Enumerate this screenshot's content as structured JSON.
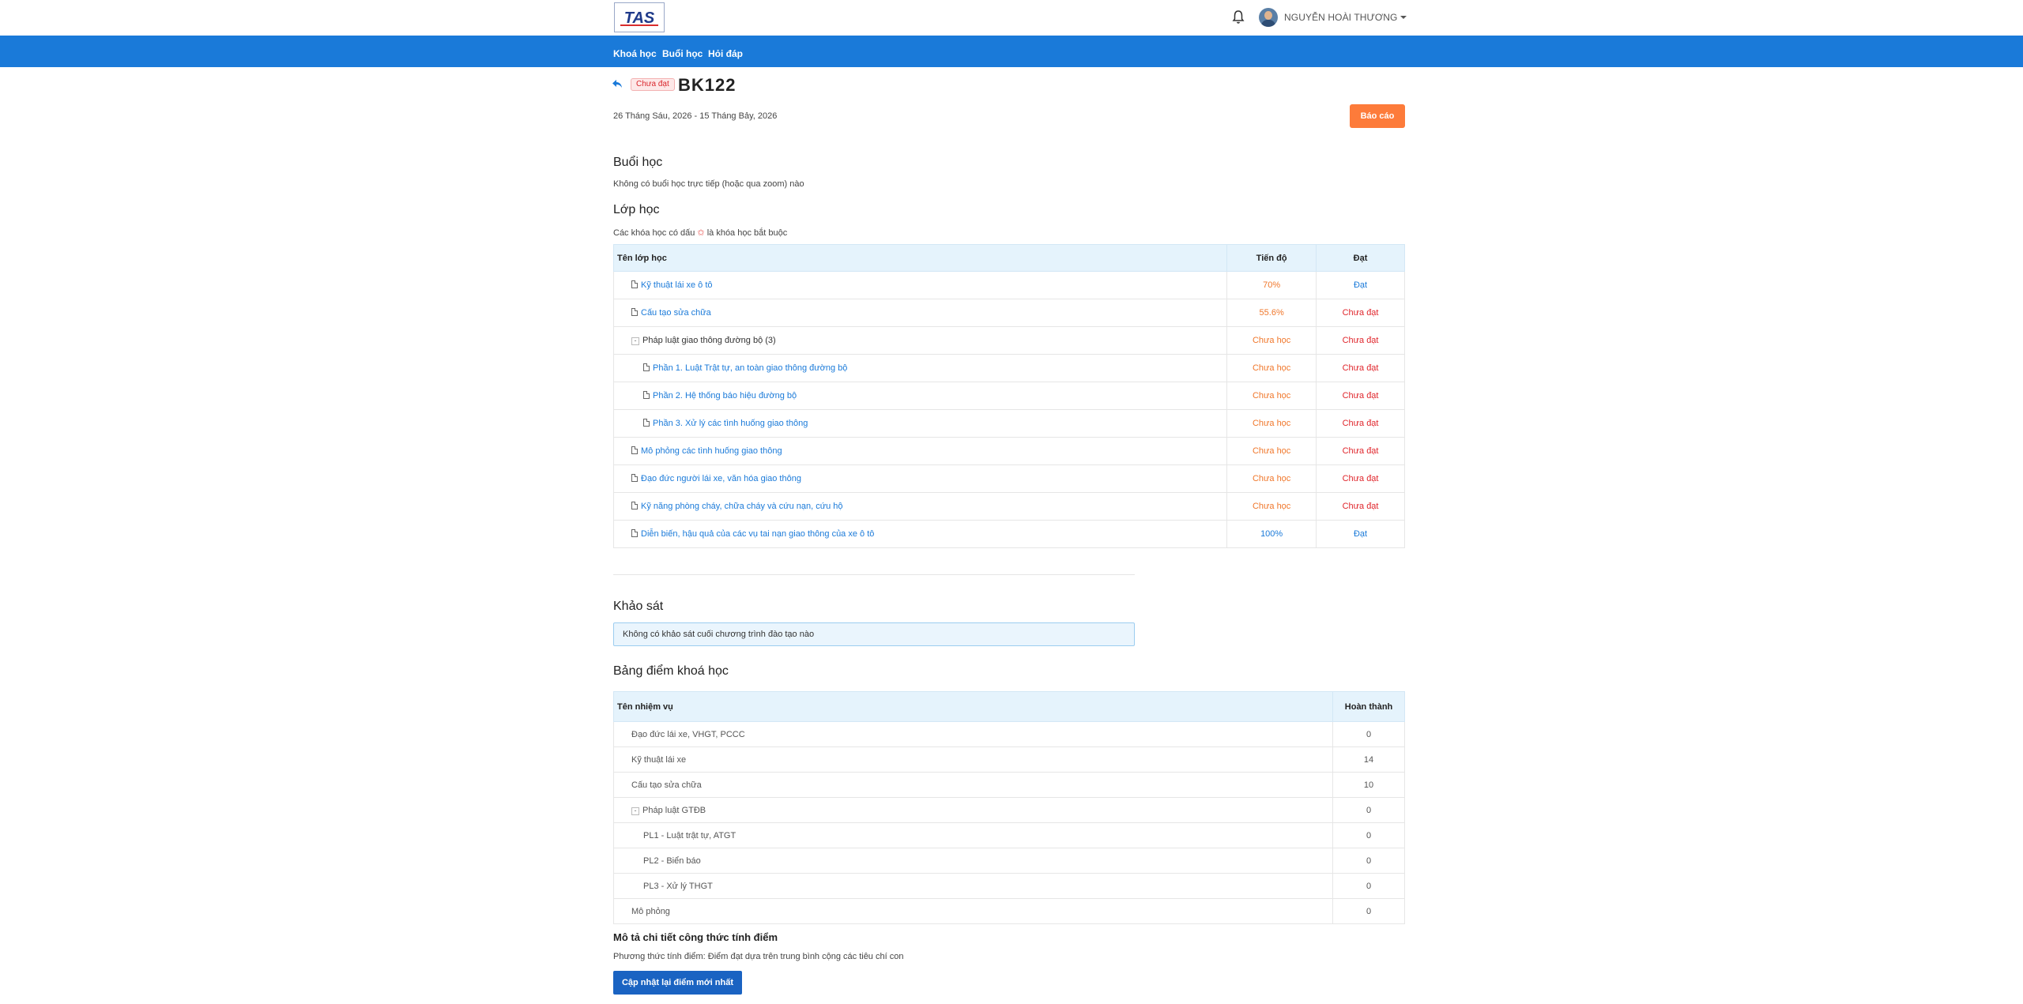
{
  "header": {
    "logo_text": "TAS",
    "user_name": "NGUYỄN HOÀI THƯƠNG"
  },
  "nav": {
    "items": [
      "Khoá học",
      "Buổi học",
      "Hỏi đáp"
    ]
  },
  "course": {
    "status_badge": "Chưa đạt",
    "code": "BK122",
    "date_range": "26 Tháng Sáu, 2026 - 15 Tháng Bảy, 2026",
    "report_button": "Báo cáo"
  },
  "sessions": {
    "title": "Buổi học",
    "empty_text": "Không có buổi học trực tiếp (hoặc qua zoom) nào"
  },
  "classes": {
    "title": "Lớp học",
    "note_before": "Các khóa học có dấu",
    "note_star": "✩",
    "note_after": "là khóa học bắt buộc",
    "headers": {
      "name": "Tên lớp học",
      "progress": "Tiến độ",
      "pass": "Đạt"
    },
    "rows": [
      {
        "name": "Kỹ thuật lái xe ô tô",
        "progress": "70%",
        "pass": "Đạt"
      },
      {
        "name": "Cấu tạo sửa chữa",
        "progress": "55.6%",
        "pass": "Chưa đạt"
      },
      {
        "name": "Pháp luật giao thông đường bộ",
        "count": "(3)",
        "progress": "Chưa học",
        "pass": "Chưa đạt"
      },
      {
        "name": "Phần 1. Luật Trật tự, an toàn giao thông đường bộ",
        "progress": "Chưa học",
        "pass": "Chưa đạt"
      },
      {
        "name": "Phần 2. Hệ thống báo hiệu đường bộ",
        "progress": "Chưa học",
        "pass": "Chưa đạt"
      },
      {
        "name": "Phần 3. Xử lý các tình huống giao thông",
        "progress": "Chưa học",
        "pass": "Chưa đạt"
      },
      {
        "name": "Mô phỏng các tình huống giao thông",
        "progress": "Chưa học",
        "pass": "Chưa đạt"
      },
      {
        "name": "Đạo đức người lái xe, văn hóa giao thông",
        "progress": "Chưa học",
        "pass": "Chưa đạt"
      },
      {
        "name": "Kỹ năng phòng cháy, chữa cháy và cứu nạn, cứu hộ",
        "progress": "Chưa học",
        "pass": "Chưa đạt"
      },
      {
        "name": "Diễn biến, hậu quả của các vụ tai nạn giao thông của xe ô tô",
        "progress": "100%",
        "pass": "Đạt"
      }
    ]
  },
  "survey": {
    "title": "Khảo sát",
    "empty_text": "Không có khảo sát cuối chương trình đào tạo nào"
  },
  "scores": {
    "title": "Bảng điểm khoá học",
    "headers": {
      "name": "Tên nhiệm vụ",
      "done": "Hoàn thành"
    },
    "rows": [
      {
        "name": "Đạo đức lái xe, VHGT, PCCC",
        "done": "0"
      },
      {
        "name": "Kỹ thuật lái xe",
        "done": "14"
      },
      {
        "name": "Cấu tạo sửa chữa",
        "done": "10"
      },
      {
        "name": "Pháp luật GTĐB",
        "done": "0"
      },
      {
        "name": "PL1 - Luật trật tự, ATGT",
        "done": "0"
      },
      {
        "name": "PL2 - Biển báo",
        "done": "0"
      },
      {
        "name": "PL3 - Xử lý THGT",
        "done": "0"
      },
      {
        "name": "Mô phỏng",
        "done": "0"
      }
    ]
  },
  "formula": {
    "title": "Mô tả chi tiết công thức tính điểm",
    "description": "Phương thức tính điểm: Điểm đạt dựa trên trung bình cộng các tiêu chí con",
    "update_button": "Cập nhật lại điểm mới nhất"
  },
  "colors": {
    "nav_blue": "#1a7ad9",
    "orange": "#f0772b",
    "red": "#e0262c",
    "report_orange": "#fd7b3a"
  }
}
